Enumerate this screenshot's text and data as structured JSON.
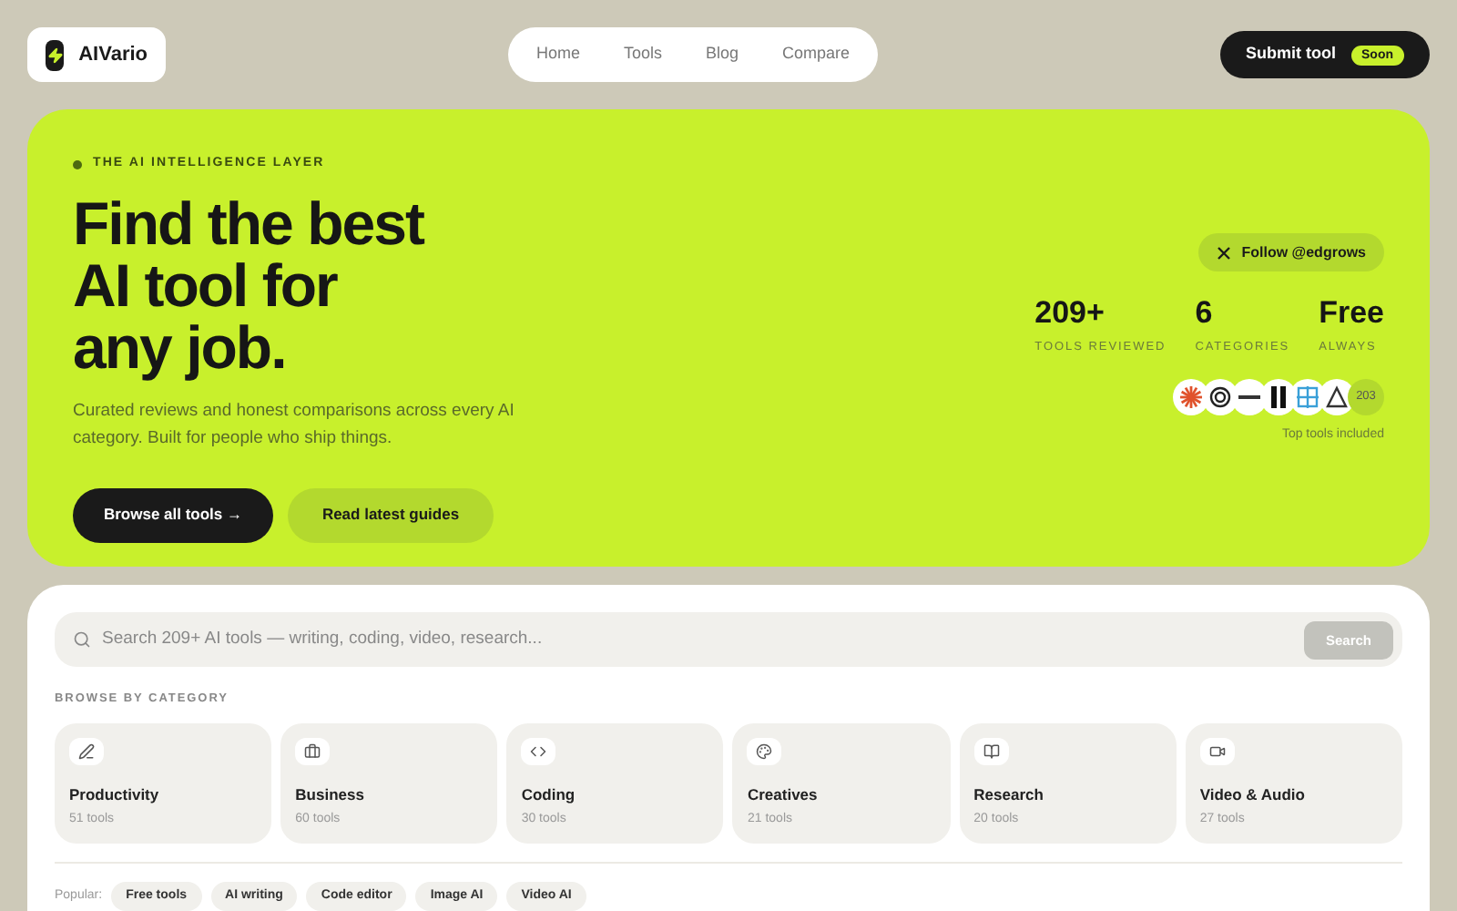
{
  "brand": {
    "name": "AIVario"
  },
  "nav": [
    {
      "label": "Home"
    },
    {
      "label": "Tools"
    },
    {
      "label": "Blog"
    },
    {
      "label": "Compare"
    }
  ],
  "submit": {
    "label": "Submit tool",
    "badge": "Soon"
  },
  "hero": {
    "eyebrow": "THE AI INTELLIGENCE LAYER",
    "title_lines": [
      "Find the best",
      "AI tool for",
      "any job."
    ],
    "subtitle": "Curated reviews and honest comparisons across every AI category. Built for people who ship things.",
    "primary_button": "Browse all tools →",
    "secondary_button": "Read latest guides",
    "follow": "Follow @edgrows",
    "stats": [
      {
        "value": "209+",
        "label": "TOOLS REVIEWED"
      },
      {
        "value": "6",
        "label": "CATEGORIES"
      },
      {
        "value": "Free",
        "label": "ALWAYS"
      }
    ],
    "logos": [
      {
        "kind": "burst"
      },
      {
        "kind": "knot"
      },
      {
        "kind": "word"
      },
      {
        "kind": "bars"
      },
      {
        "kind": "grid"
      },
      {
        "kind": "sail"
      }
    ],
    "more_count": "203",
    "logos_caption": "Top tools included"
  },
  "search": {
    "placeholder": "Search 209+ AI tools — writing, coding, video, research...",
    "button": "Search"
  },
  "browse_heading": "BROWSE BY CATEGORY",
  "categories": [
    {
      "kind": "pen",
      "name": "Productivity",
      "count": "51 tools"
    },
    {
      "kind": "briefcase",
      "name": "Business",
      "count": "60 tools"
    },
    {
      "kind": "code",
      "name": "Coding",
      "count": "30 tools"
    },
    {
      "kind": "palette",
      "name": "Creatives",
      "count": "21 tools"
    },
    {
      "kind": "book",
      "name": "Research",
      "count": "20 tools"
    },
    {
      "kind": "video",
      "name": "Video & Audio",
      "count": "27 tools"
    }
  ],
  "popular": {
    "label": "Popular:",
    "tags": [
      "Free tools",
      "AI writing",
      "Code editor",
      "Image AI",
      "Video AI"
    ]
  }
}
